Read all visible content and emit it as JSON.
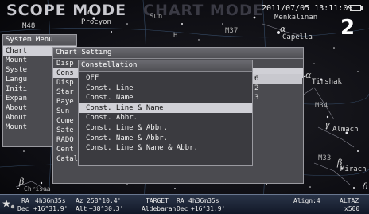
{
  "header": {
    "mode_scope": "SCOPE MODE",
    "mode_chart": "CHART MODE",
    "datetime": "2011/07/05 13:11:09",
    "screen_number": "2"
  },
  "sky_labels": {
    "m48": "M48",
    "procyon": "Procyon",
    "sun": "Sun",
    "m37": "M37",
    "menkalinan": "Menkalinan",
    "capella": "Capella",
    "m34": "M34",
    "tirshak": "Tirshak",
    "alamak": "Almach",
    "m33": "M33",
    "mirach": "Mirach",
    "chrisaa": "Chrisaa",
    "h": "H"
  },
  "system_menu": {
    "title": "System Menu",
    "items": [
      "Chart",
      "Mount",
      "Syste",
      "Langu",
      "Initi",
      "Expan",
      "About",
      "About",
      "Mount"
    ]
  },
  "chart_setting": {
    "title": "Chart Setting",
    "items": [
      "Disp",
      "Cons",
      "Disp",
      "Star",
      "Baye",
      "Sun",
      "Come",
      "Sate",
      "RADO",
      "Cent",
      "Catalogue Objects"
    ],
    "values": [
      "6",
      "2",
      "3"
    ],
    "selected_index": 1
  },
  "constellation": {
    "title": "Constellation",
    "items": [
      "OFF",
      "Const. Line",
      "Const. Name",
      "Const. Line & Name",
      "Const. Abbr.",
      "Const. Line & Abbr.",
      "Const. Name & Abbr.",
      "Const. Line & Name & Abbr."
    ],
    "selected_index": 3
  },
  "status": {
    "ra_label": "RA",
    "ra_value": "4h36m35s",
    "dec_label": "Dec",
    "dec_value": "+16°31.9'",
    "az_label": "Az",
    "az_value": "258°10.4'",
    "alt_label": "Alt",
    "alt_value": "+38°30.3'",
    "target_label": "TARGET",
    "target_name": "Aldebaran",
    "target_ra_label": "RA",
    "target_ra_value": "4h36m35s",
    "target_dec_label": "Dec",
    "target_dec_value": "+16°31.9'",
    "align_label": "Align:4",
    "altaz_label": "ALTAZ",
    "zoom": "x500"
  }
}
